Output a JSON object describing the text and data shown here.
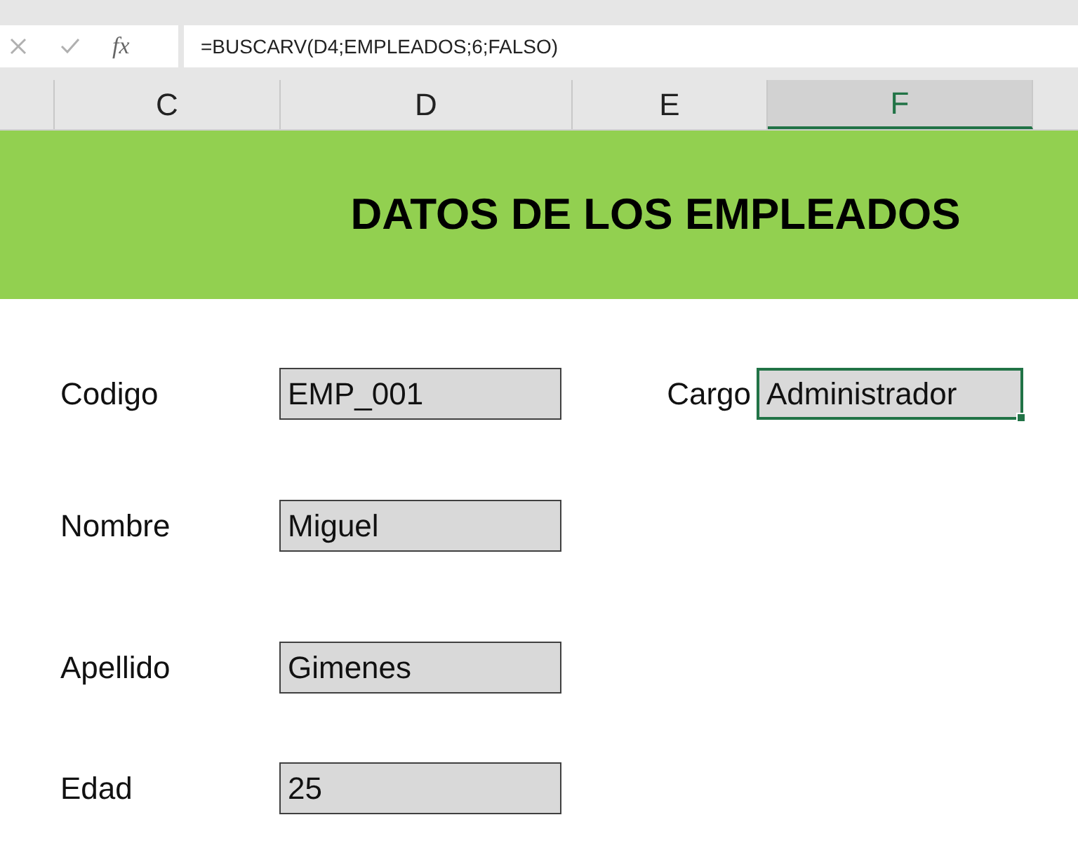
{
  "formula_bar": {
    "function_label": "fx",
    "formula": "=BUSCARV(D4;EMPLEADOS;6;FALSO)"
  },
  "columns": [
    {
      "label": "C",
      "selected": false
    },
    {
      "label": "D",
      "selected": false
    },
    {
      "label": "E",
      "selected": false
    },
    {
      "label": "F",
      "selected": true
    }
  ],
  "title": "DATOS DE LOS EMPLEADOS",
  "fields": [
    {
      "label": "Codigo",
      "value": "EMP_001"
    },
    {
      "label": "Nombre",
      "value": "Miguel"
    },
    {
      "label": "Apellido",
      "value": "Gimenes"
    },
    {
      "label": "Edad",
      "value": "25"
    }
  ],
  "result": {
    "label": "Cargo",
    "value": "Administrador",
    "selected": true
  }
}
